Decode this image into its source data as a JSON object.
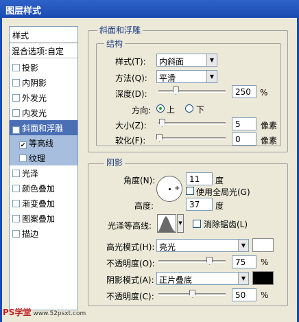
{
  "window": {
    "title": "图层样式"
  },
  "left_list": {
    "header": "样式",
    "blend_options": "混合选项:自定",
    "items": [
      {
        "label": "投影",
        "checked": false
      },
      {
        "label": "内阴影",
        "checked": false
      },
      {
        "label": "外发光",
        "checked": false
      },
      {
        "label": "内发光",
        "checked": false
      },
      {
        "label": "斜面和浮雕",
        "checked": true,
        "selected": true
      },
      {
        "label": "等高线",
        "checked": true,
        "sub": true
      },
      {
        "label": "纹理",
        "checked": false,
        "sub": true
      },
      {
        "label": "光泽",
        "checked": false
      },
      {
        "label": "颜色叠加",
        "checked": false
      },
      {
        "label": "渐变叠加",
        "checked": false
      },
      {
        "label": "图案叠加",
        "checked": false
      },
      {
        "label": "描边",
        "checked": false
      }
    ]
  },
  "bevel": {
    "title": "斜面和浮雕",
    "structure": {
      "title": "结构",
      "style_label": "样式(T):",
      "style_value": "内斜面",
      "technique_label": "方法(Q):",
      "technique_value": "平滑",
      "depth_label": "深度(D):",
      "depth_value": "250",
      "depth_unit": "%",
      "direction_label": "方向:",
      "direction_up": "上",
      "direction_down": "下",
      "size_label": "大小(Z):",
      "size_value": "5",
      "size_unit": "像素",
      "soften_label": "软化(F):",
      "soften_value": "0",
      "soften_unit": "像素"
    },
    "shading": {
      "title": "阴影",
      "angle_label": "角度(N):",
      "angle_value": "11",
      "angle_unit": "度",
      "global_light_label": "使用全局光(G)",
      "altitude_label": "高度:",
      "altitude_value": "37",
      "altitude_unit": "度",
      "gloss_contour_label": "光泽等高线:",
      "antialiased_label": "消除锯齿(L)",
      "highlight_mode_label": "高光模式(H):",
      "highlight_mode_value": "亮光",
      "highlight_color": "#ffffff",
      "highlight_opacity_label": "不透明度(O):",
      "highlight_opacity_value": "75",
      "shadow_mode_label": "阴影模式(A):",
      "shadow_mode_value": "正片叠底",
      "shadow_color": "#000000",
      "shadow_opacity_label": "不透明度(C):",
      "shadow_opacity_value": "50",
      "percent_unit": "%"
    }
  },
  "watermark": {
    "brand": "PS学堂",
    "site": "www.52psxt.com"
  }
}
